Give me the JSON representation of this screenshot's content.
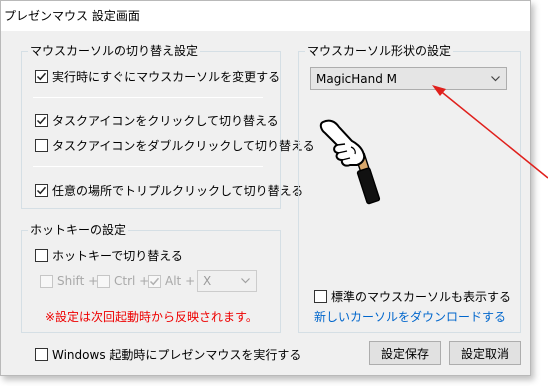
{
  "window": {
    "title": "プレゼンマウス 設定画面"
  },
  "switch_group": {
    "label": "マウスカーソルの切り替え設定",
    "options": [
      {
        "label": "実行時にすぐにマウスカーソルを変更する",
        "checked": true
      },
      {
        "label": "タスクアイコンをクリックして切り替える",
        "checked": true
      },
      {
        "label": "タスクアイコンをダブルクリックして切り替える",
        "checked": false
      },
      {
        "label": "任意の場所でトリプルクリックして切り替える",
        "checked": true
      }
    ]
  },
  "hotkey_group": {
    "label": "ホットキーの設定",
    "enable_label": "ホットキーで切り替える",
    "enable_checked": false,
    "shift_label": "Shift +",
    "ctrl_label": "Ctrl +",
    "alt_label": "Alt +",
    "alt_checked": true,
    "key_value": "X",
    "note": "※設定は次回起動時から反映されます。"
  },
  "shape_group": {
    "label": "マウスカーソル形状の設定",
    "selected": "MagicHand M",
    "preview_icon": "pointing-hand-cursor",
    "show_standard_label": "標準のマウスカーソルも表示する",
    "show_standard_checked": false,
    "download_link": "新しいカーソルをダウンロードする"
  },
  "footer": {
    "startup_label": "Windows 起動時にプレゼンマウスを実行する",
    "startup_checked": false,
    "save_label": "設定保存",
    "cancel_label": "設定取消"
  },
  "colors": {
    "note_red": "#ee0000",
    "link_blue": "#0066cc",
    "arrow_red": "#e0201c"
  }
}
